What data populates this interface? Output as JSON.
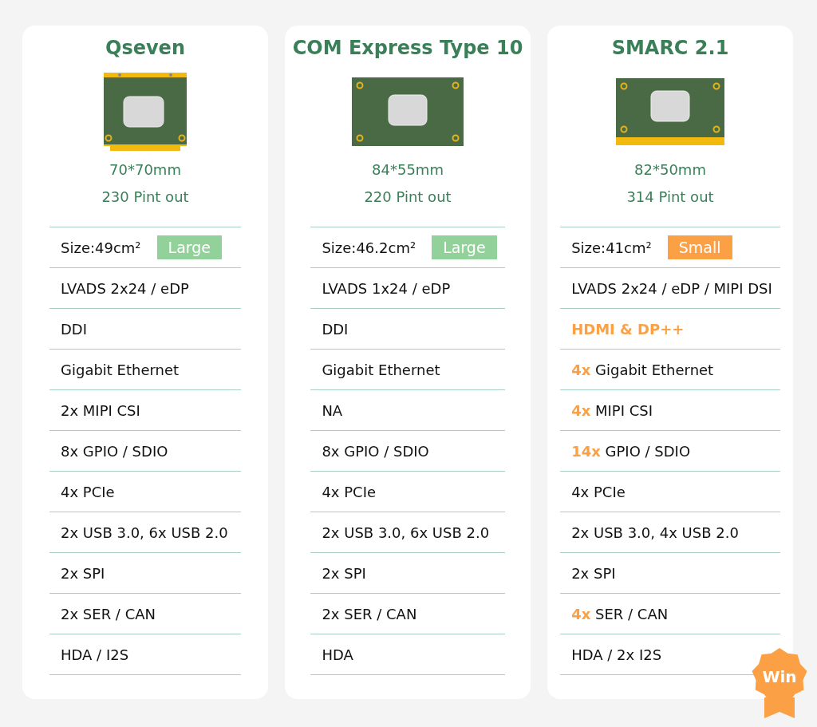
{
  "cards": [
    {
      "title": "Qseven",
      "kind": "qseven",
      "dimensions": "70*70mm",
      "pinout": "230 Pint out",
      "size": "Size:49cm²",
      "size_tag": {
        "label": "Large",
        "color": "#93d19b"
      },
      "specs": [
        {
          "text": "LVADS 2x24 / eDP",
          "highlight": false
        },
        {
          "text": "DDI",
          "highlight": false
        },
        {
          "text": "Gigabit Ethernet",
          "highlight": false
        },
        {
          "text": "2x MIPI CSI",
          "highlight": false
        },
        {
          "text": "8x GPIO / SDIO",
          "highlight": false
        },
        {
          "text": "4x PCIe",
          "highlight": false
        },
        {
          "text": "2x USB 3.0, 6x USB 2.0",
          "highlight": false
        },
        {
          "text": "2x SPI",
          "highlight": false
        },
        {
          "text": "2x SER / CAN",
          "highlight": false
        },
        {
          "text": "HDA / I2S",
          "highlight": false
        }
      ]
    },
    {
      "title": "COM Express Type 10",
      "kind": "comexpress",
      "dimensions": "84*55mm",
      "pinout": "220 Pint out",
      "size": "Size:46.2cm²",
      "size_tag": {
        "label": "Large",
        "color": "#93d19b"
      },
      "specs": [
        {
          "text": "LVADS 1x24 / eDP",
          "highlight": false
        },
        {
          "text": "DDI",
          "highlight": false
        },
        {
          "text": "Gigabit Ethernet",
          "highlight": false
        },
        {
          "text": "NA",
          "highlight": false
        },
        {
          "text": "8x GPIO / SDIO",
          "highlight": false
        },
        {
          "text": "4x PCIe",
          "highlight": false
        },
        {
          "text": "2x USB 3.0, 6x USB 2.0",
          "highlight": false
        },
        {
          "text": "2x SPI",
          "highlight": false
        },
        {
          "text": "2x SER / CAN",
          "highlight": false
        },
        {
          "text": "HDA",
          "highlight": false
        }
      ]
    },
    {
      "title": "SMARC 2.1",
      "kind": "smarc",
      "dimensions": "82*50mm",
      "pinout": "314 Pint out",
      "size": "Size:41cm²",
      "size_tag": {
        "label": "Small",
        "color": "#fba044"
      },
      "badge": "Win",
      "specs": [
        {
          "text": "LVADS 2x24 / eDP / MIPI DSI",
          "highlight": false
        },
        {
          "text": "HDMI & DP++",
          "highlight": true
        },
        {
          "text": "**4x** Gigabit Ethernet",
          "highlight": false
        },
        {
          "text": "**4x** MIPI CSI",
          "highlight": false
        },
        {
          "text": "**14x** GPIO / SDIO",
          "highlight": false
        },
        {
          "text": "4x PCIe",
          "highlight": false
        },
        {
          "text": "2x USB 3.0, 4x USB 2.0",
          "highlight": false
        },
        {
          "text": "2x SPI",
          "highlight": false
        },
        {
          "text": "**4x** SER / CAN",
          "highlight": false
        },
        {
          "text": "HDA / 2x I2S",
          "highlight": false
        }
      ]
    }
  ]
}
